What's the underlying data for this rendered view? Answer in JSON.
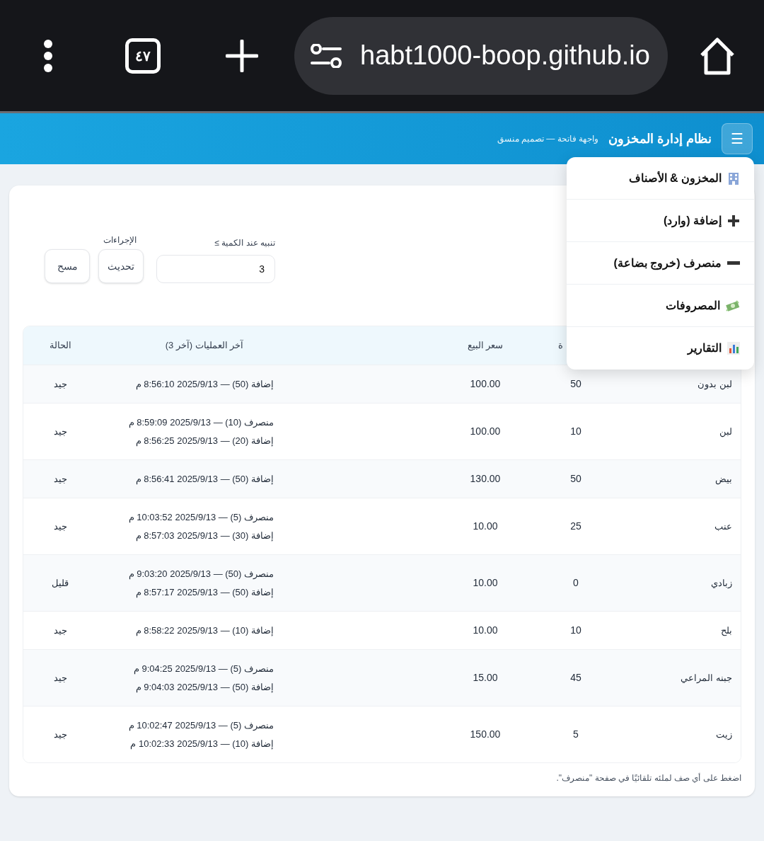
{
  "browser": {
    "tab_count": "٤٧",
    "url": "habt1000-boop.github.io"
  },
  "header": {
    "menu_button": "☰",
    "title": "نظام إدارة المخزون",
    "subtitle": "واجهة فاتحة — تصميم منسق"
  },
  "menu": {
    "items": [
      {
        "label": "المخزون & الأصناف"
      },
      {
        "label": "إضافة (وارد)"
      },
      {
        "label": "منصرف (خروج بضاعة)"
      },
      {
        "label": "المصروفات"
      },
      {
        "label": "التقارير"
      }
    ]
  },
  "filters": {
    "threshold_label": "تنبيه عند الكمية ≥",
    "threshold_value": "3",
    "actions_label": "الإجراءات",
    "buttons": [
      "تحديث",
      "مسح"
    ]
  },
  "table": {
    "columns": [
      "ة",
      "سعر البيع",
      "آخر العمليات (آخر 3)",
      "الحالة"
    ],
    "rows": [
      {
        "name": "لبن بدون",
        "qty": "50",
        "price": "100.00",
        "ops": [
          "إضافة (50) — 2025/9/13 8:56:10 م"
        ],
        "status": "جيد"
      },
      {
        "name": "لبن",
        "qty": "10",
        "price": "100.00",
        "ops": [
          "منصرف (10) — 2025/9/13 8:59:09 م",
          "إضافة (20) — 2025/9/13 8:56:25 م"
        ],
        "status": "جيد"
      },
      {
        "name": "بيض",
        "qty": "50",
        "price": "130.00",
        "ops": [
          "إضافة (50) — 2025/9/13 8:56:41 م"
        ],
        "status": "جيد"
      },
      {
        "name": "عنب",
        "qty": "25",
        "price": "10.00",
        "ops": [
          "منصرف (5) — 2025/9/13 10:03:52 م",
          "إضافة (30) — 2025/9/13 8:57:03 م"
        ],
        "status": "جيد"
      },
      {
        "name": "زبادي",
        "qty": "0",
        "price": "10.00",
        "ops": [
          "منصرف (50) — 2025/9/13 9:03:20 م",
          "إضافة (50) — 2025/9/13 8:57:17 م"
        ],
        "status": "قليل"
      },
      {
        "name": "بلح",
        "qty": "10",
        "price": "10.00",
        "ops": [
          "إضافة (10) — 2025/9/13 8:58:22 م"
        ],
        "status": "جيد"
      },
      {
        "name": "جبنه المراعي",
        "qty": "45",
        "price": "15.00",
        "ops": [
          "منصرف (5) — 2025/9/13 9:04:25 م",
          "إضافة (50) — 2025/9/13 9:04:03 م"
        ],
        "status": "جيد"
      },
      {
        "name": "زيت",
        "qty": "5",
        "price": "150.00",
        "ops": [
          "منصرف (5) — 2025/9/13 10:02:47 م",
          "إضافة (10) — 2025/9/13 10:02:33 م"
        ],
        "status": "جيد"
      }
    ]
  },
  "note": "اضغط على أي صف لملئه تلقائيًا في صفحة \"منصرف\"."
}
